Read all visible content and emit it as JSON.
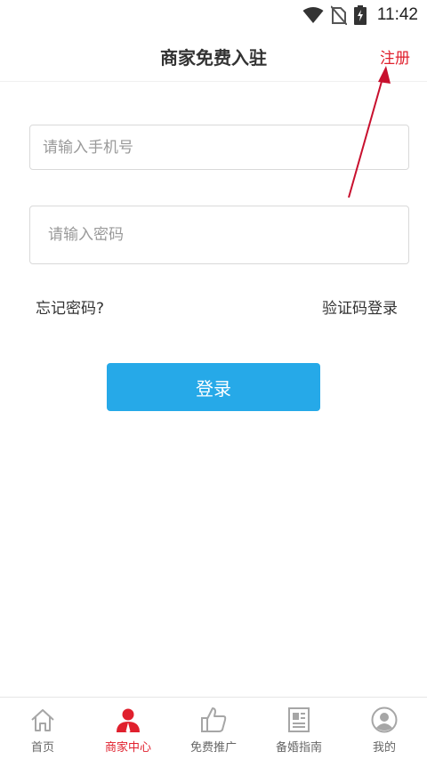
{
  "status_bar": {
    "time": "11:42",
    "icons": [
      "wifi-icon",
      "no-sim-icon",
      "battery-charging-icon"
    ]
  },
  "header": {
    "title": "商家免费入驻",
    "register_label": "注册"
  },
  "form": {
    "phone_placeholder": "请输入手机号",
    "password_placeholder": "请输入密码",
    "forgot_label": "忘记密码?",
    "sms_login_label": "验证码登录",
    "login_label": "登录"
  },
  "tabbar": {
    "items": [
      {
        "label": "首页",
        "icon": "home-icon",
        "active": false
      },
      {
        "label": "商家中心",
        "icon": "merchant-icon",
        "active": true
      },
      {
        "label": "免费推广",
        "icon": "thumbs-up-icon",
        "active": false
      },
      {
        "label": "备婚指南",
        "icon": "guide-icon",
        "active": false
      },
      {
        "label": "我的",
        "icon": "profile-icon",
        "active": false
      }
    ]
  },
  "colors": {
    "accent_red": "#e0202d",
    "login_button": "#26a9e8",
    "inactive_icon": "#a6a6a6"
  }
}
